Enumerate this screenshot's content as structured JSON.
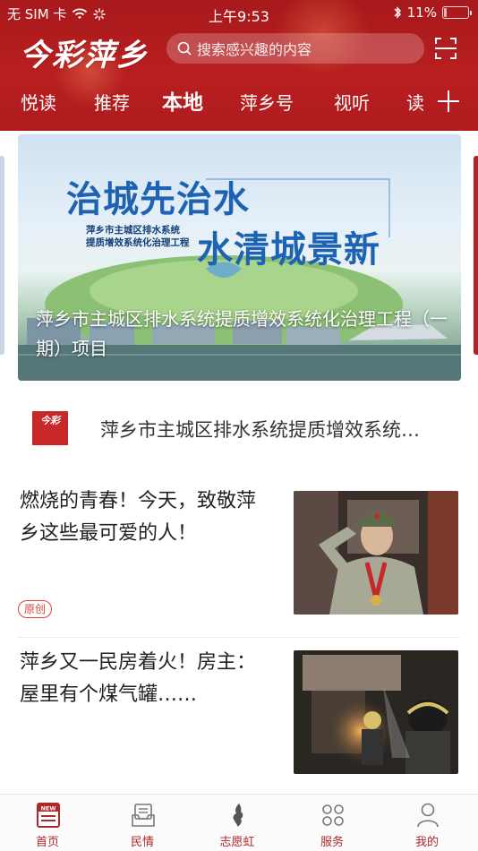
{
  "status_bar": {
    "carrier": "无 SIM 卡",
    "time": "上午9:53",
    "battery_percent": "11%",
    "battery_level": 0.11
  },
  "header": {
    "logo_text": "今彩萍乡",
    "search_placeholder": "搜索感兴趣的内容",
    "brand_color": "#b81e20"
  },
  "tabs": [
    {
      "label": "悦读",
      "active": false
    },
    {
      "label": "推荐",
      "active": false
    },
    {
      "label": "本地",
      "active": true
    },
    {
      "label": "萍乡号",
      "active": false
    },
    {
      "label": "视听",
      "active": false
    },
    {
      "label": "读",
      "active": false
    }
  ],
  "banner": {
    "headline_1": "治城先治水",
    "headline_2": "水清城景新",
    "subtitle_1": "萍乡市主城区排水系统",
    "subtitle_2": "提质增效系统化治理工程",
    "caption": "萍乡市主城区排水系统提质增效系统化治理工程（一期）项目"
  },
  "ticker": {
    "logo_text": "今彩",
    "text": "萍乡市主城区排水系统提质增效系统…"
  },
  "articles": [
    {
      "title": "燃烧的青春！今天，致敬萍乡这些最可爱的人！",
      "badge": "原创"
    },
    {
      "title": "萍乡又一民房着火！房主：屋里有个煤气罐……",
      "badge": ""
    }
  ],
  "tabbar": [
    {
      "label": "首页",
      "icon": "news-icon"
    },
    {
      "label": "民情",
      "icon": "inbox-icon"
    },
    {
      "label": "志愿虹",
      "icon": "volunteer-icon"
    },
    {
      "label": "服务",
      "icon": "grid-icon"
    },
    {
      "label": "我的",
      "icon": "person-icon"
    }
  ]
}
